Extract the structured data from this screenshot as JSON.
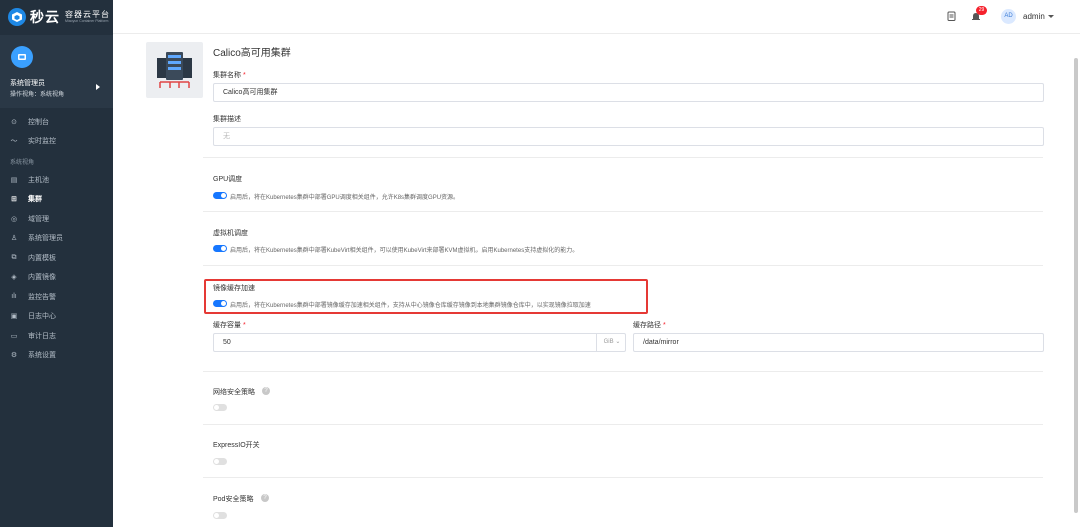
{
  "app": {
    "logo_name": "秒云",
    "logo_cn": "容器云平台",
    "logo_en": "Miaoyun Container Platform"
  },
  "user_panel": {
    "name": "系统管理员",
    "role": "操作视角：系统视角"
  },
  "sidebar": {
    "group_label": "系统视角",
    "items": [
      {
        "label": "控制台",
        "icon": "⊙"
      },
      {
        "label": "实时监控",
        "icon": "〜"
      },
      {
        "label": "主机池",
        "icon": "▤"
      },
      {
        "label": "集群",
        "icon": "⊞"
      },
      {
        "label": "域管理",
        "icon": "◎"
      },
      {
        "label": "系统管理员",
        "icon": "♙"
      },
      {
        "label": "内置模板",
        "icon": "⧉"
      },
      {
        "label": "内置镜像",
        "icon": "◈"
      },
      {
        "label": "监控告警",
        "icon": "ılı"
      },
      {
        "label": "日志中心",
        "icon": "▣"
      },
      {
        "label": "审计日志",
        "icon": "▭"
      },
      {
        "label": "系统设置",
        "icon": "⚙"
      }
    ],
    "active": "集群"
  },
  "topbar": {
    "notification_count": "29",
    "avatar_initials": "AD",
    "username": "admin"
  },
  "cluster": {
    "title": "Calico高可用集群",
    "name_label": "集群名称",
    "name_value": "Calico高可用集群",
    "desc_label": "集群描述",
    "desc_placeholder": "无"
  },
  "gpu": {
    "label": "GPU调度",
    "enabled": true,
    "description": "启用后，将在Kubernetes集群中部署GPU调度相关组件，允许K8s集群调度GPU资源。"
  },
  "vm": {
    "label": "虚拟机调度",
    "enabled": true,
    "description": "启用后，将在Kubernetes集群中部署KubeVirt相关组件，可以使用KubeVirt来部署KVM虚拟机，启用Kubernetes支持虚拟化的能力。"
  },
  "mirror": {
    "label": "镜像缓存加速",
    "enabled": true,
    "description": "启用后，将在Kubernetes集群中部署镜像缓存加速相关组件，支持从中心镜像仓库缓存镜像到本地集群镜像仓库中，以实现镜像拉取加速",
    "capacity_label": "缓存容量",
    "capacity_value": "50",
    "capacity_unit": "GiB",
    "path_label": "缓存路径",
    "path_value": "/data/mirror"
  },
  "network_policy": {
    "label": "网络安全策略",
    "enabled": false
  },
  "expressio": {
    "label": "ExpressIO开关",
    "enabled": false
  },
  "pod_policy": {
    "label": "Pod安全策略",
    "enabled": false
  },
  "colors": {
    "primary": "#1677ff",
    "sidebar_bg": "#23303d",
    "highlight": "#e53935",
    "badge": "#f5222d"
  }
}
